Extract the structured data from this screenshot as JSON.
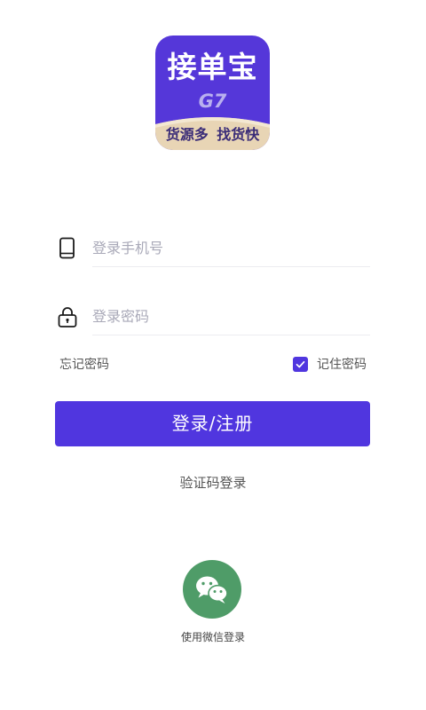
{
  "logo": {
    "title": "接单宝",
    "subtitle": "G7",
    "slogan": "货源多 找货快"
  },
  "phone": {
    "placeholder": "登录手机号",
    "icon": "phone-icon"
  },
  "password": {
    "placeholder": "登录密码",
    "icon": "lock-icon"
  },
  "options": {
    "forgot_label": "忘记密码",
    "remember_label": "记住密码",
    "remember_checked": true
  },
  "login_button": "登录/注册",
  "sms_login": "验证码登录",
  "wechat": {
    "label": "使用微信登录",
    "icon": "wechat-icon"
  },
  "colors": {
    "primary": "#5036df",
    "logo_bg": "#5537d9",
    "wechat": "#4f9c68"
  }
}
